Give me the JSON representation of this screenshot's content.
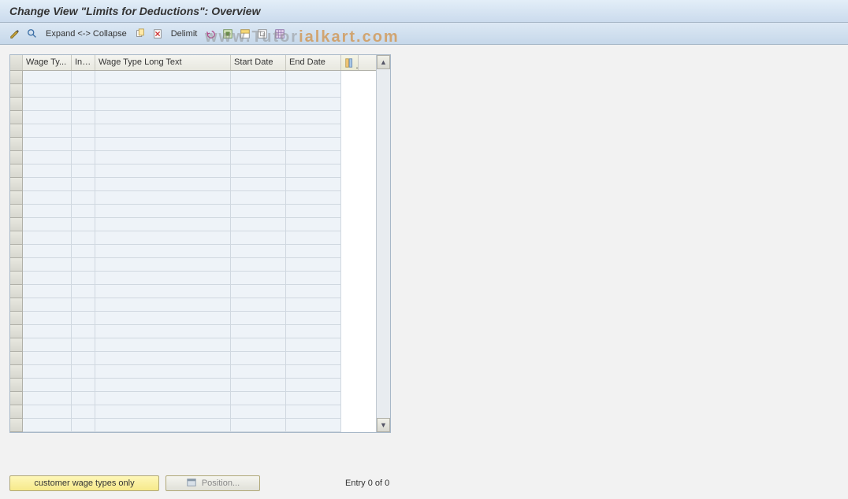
{
  "title": "Change View \"Limits for Deductions\": Overview",
  "toolbar": {
    "expand_collapse": "Expand <-> Collapse",
    "delimit": "Delimit"
  },
  "table": {
    "headers": {
      "wage_type": "Wage Ty...",
      "inf": "Inf...",
      "long_text": "Wage Type Long Text",
      "start_date": "Start Date",
      "end_date": "End Date"
    },
    "row_count": 27
  },
  "footer": {
    "customer_btn": "customer wage types only",
    "position_btn": "Position...",
    "entry_text": "Entry 0 of 0"
  },
  "watermark": {
    "grey": "www.Tutor",
    "orange": "ialkart.com"
  }
}
